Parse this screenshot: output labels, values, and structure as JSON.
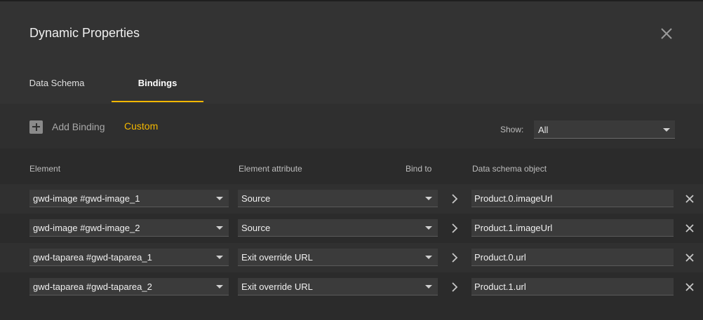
{
  "dialog": {
    "title": "Dynamic Properties"
  },
  "tabs": [
    {
      "label": "Data Schema",
      "active": false
    },
    {
      "label": "Bindings",
      "active": true
    }
  ],
  "toolbar": {
    "add_binding_label": "Add Binding",
    "custom_label": "Custom",
    "show_label": "Show:",
    "show_value": "All"
  },
  "columns": {
    "element": "Element",
    "attribute": "Element attribute",
    "bind_to": "Bind to",
    "schema_object": "Data schema object"
  },
  "bindings": [
    {
      "element": "gwd-image #gwd-image_1",
      "attribute": "Source",
      "schema_object": "Product.0.imageUrl"
    },
    {
      "element": "gwd-image #gwd-image_2",
      "attribute": "Source",
      "schema_object": "Product.1.imageUrl"
    },
    {
      "element": "gwd-taparea #gwd-taparea_1",
      "attribute": "Exit override URL",
      "schema_object": "Product.0.url"
    },
    {
      "element": "gwd-taparea #gwd-taparea_2",
      "attribute": "Exit override URL",
      "schema_object": "Product.1.url"
    }
  ],
  "icons": {
    "close": "close-icon",
    "add": "plus-box-icon",
    "dropdown": "caret-down-icon",
    "bind_arrow": "chevron-right-icon",
    "remove": "remove-icon"
  },
  "colors": {
    "accent": "#f5b800",
    "header_bg": "#333333",
    "body_bg": "#2b2b2b"
  }
}
